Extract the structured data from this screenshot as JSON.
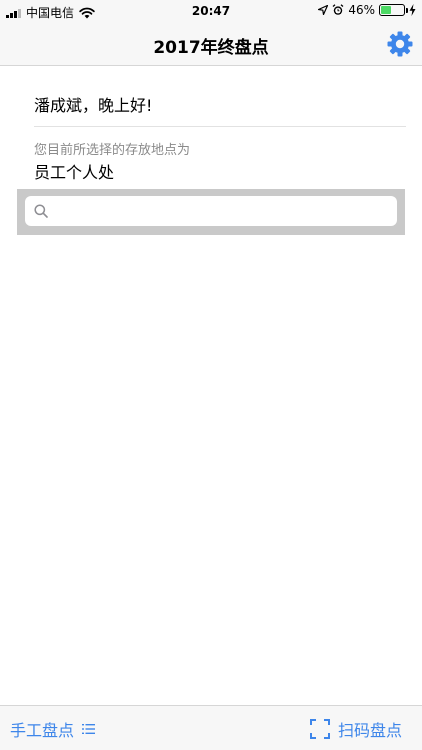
{
  "status": {
    "carrier": "中国电信",
    "time": "20:47",
    "battery": "46%",
    "battery_level": 46,
    "icons": [
      "signal-icon",
      "wifi-icon",
      "location-arrow-icon",
      "alarm-icon",
      "battery-icon",
      "charging-icon"
    ]
  },
  "nav": {
    "title": "2017年终盘点",
    "settings_icon": "gear-icon"
  },
  "main": {
    "greeting": "潘成斌，晚上好!",
    "location_label": "您目前所选择的存放地点为",
    "location_value": "员工个人处"
  },
  "search": {
    "placeholder": "",
    "value": "",
    "icon": "search-icon"
  },
  "toolbar": {
    "manual_label": "手工盘点",
    "manual_icon": "list-icon",
    "scan_label": "扫码盘点",
    "scan_icon": "scan-frame-icon"
  },
  "colors": {
    "accent": "#3e86ea",
    "bar_background": "#f7f7f7",
    "search_background": "#c9c9c9",
    "battery_green": "#4cd964"
  }
}
